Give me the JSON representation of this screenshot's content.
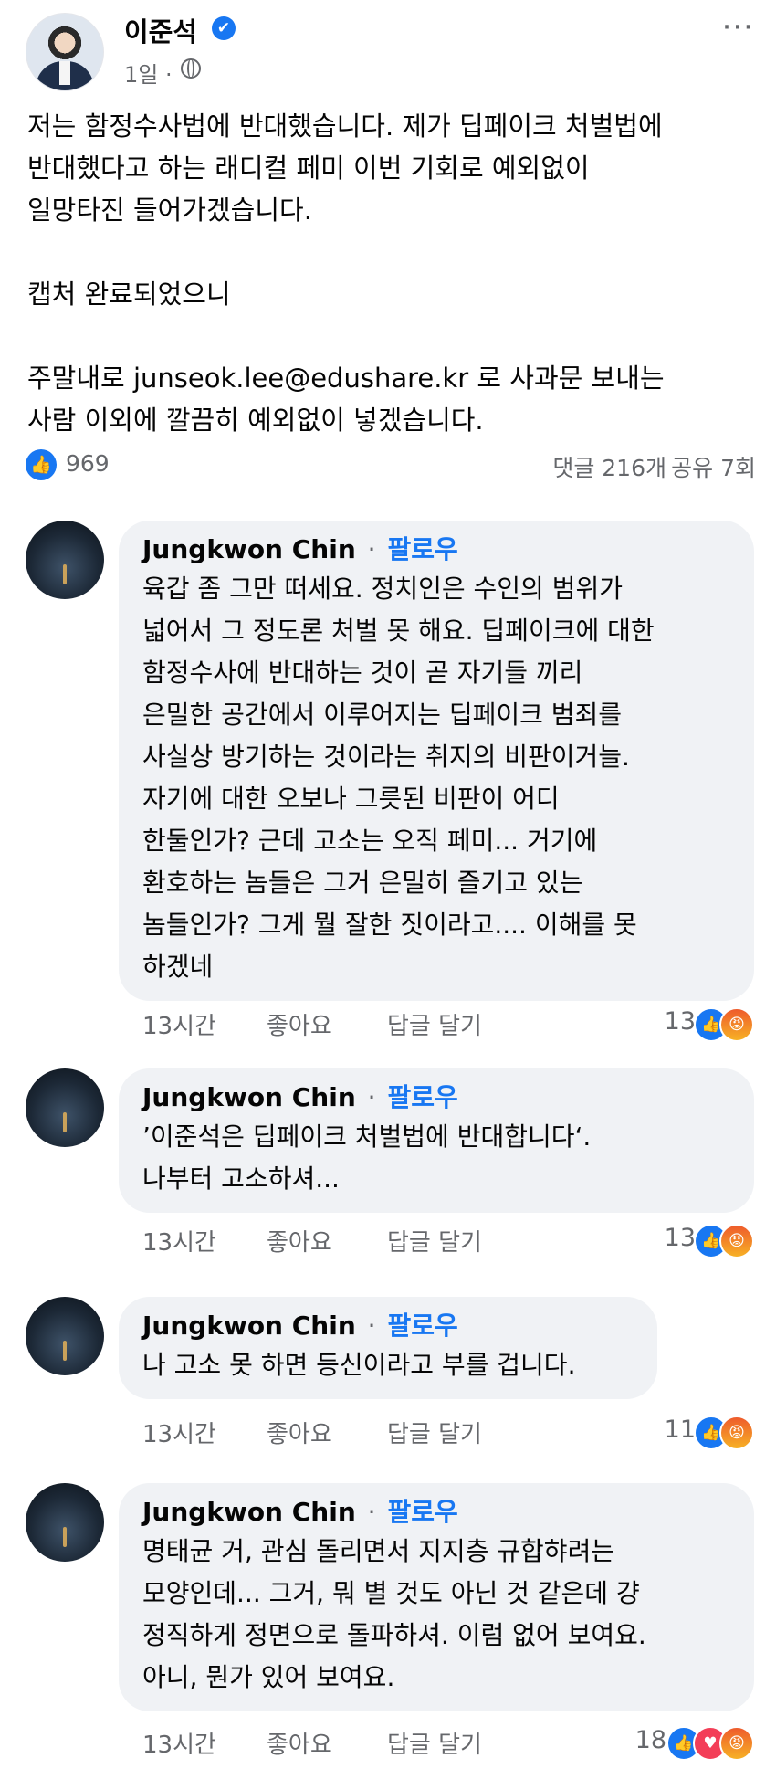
{
  "post": {
    "author": "이준석",
    "time": "1일 ·",
    "more": "⋮⋮⋮",
    "lines": [
      "저는 함정수사법에 반대했습니다. 제가 딥페이크 처벌법에",
      "반대했다고 하는 래디컬 페미 이번 기회로 예외없이",
      "일망타진 들어가겠습니다.",
      "",
      "캡처 완료되었으니",
      "",
      "주말내로 junseok.lee@edushare.kr 로 사과문 보내는",
      "사람 이외에 깔끔히 예외없이 넣겠습니다."
    ],
    "like_count": "969",
    "comments_count": "댓글 216개",
    "share_count": "공유 7회"
  },
  "icons": {
    "verified": "✔",
    "like": "👍",
    "love": "♥",
    "angry": "😡"
  },
  "comments": [
    {
      "name": "Jungkwon Chin",
      "dot": "·",
      "follow": "팔로우",
      "lines": [
        "육갑 좀 그만 떠세요. 정치인은 수인의 범위가",
        "넓어서 그 정도론 처벌 못 해요. 딥페이크에 대한",
        "함정수사에 반대하는 것이 곧 자기들 끼리",
        "은밀한 공간에서 이루어지는 딥페이크 범죄를",
        "사실상 방기하는 것이라는 취지의 비판이거늘.",
        "자기에 대한 오보나 그릇된 비판이 어디",
        "한둘인가? 근데 고소는 오직 페미... 거기에",
        "환호하는 놈들은 그거 은밀히 즐기고 있는",
        "놈들인가? 그게 뭘 잘한 짓이라고.... 이해를 못",
        "하겠네"
      ],
      "time": "13시간",
      "like_label": "좋아요",
      "reply_label": "답글 달기",
      "reactions": "13"
    },
    {
      "name": "Jungkwon Chin",
      "dot": "·",
      "follow": "팔로우",
      "lines": [
        "’이준석은 딥페이크 처벌법에 반대합니다‘.",
        "나부터 고소하셔..."
      ],
      "time": "13시간",
      "like_label": "좋아요",
      "reply_label": "답글 달기",
      "reactions": "13"
    },
    {
      "name": "Jungkwon Chin",
      "dot": "·",
      "follow": "팔로우",
      "lines": [
        "나 고소 못 하면 등신이라고 부를 겁니다."
      ],
      "time": "13시간",
      "like_label": "좋아요",
      "reply_label": "답글 달기",
      "reactions": "11"
    },
    {
      "name": "Jungkwon Chin",
      "dot": "·",
      "follow": "팔로우",
      "lines": [
        "명태균 거, 관심 돌리면서 지지층 규합햐려는",
        "모양인데... 그거, 뭐 별 것도 아닌 것 같은데 걍",
        "정직하게 정면으로 돌파하셔. 이럼 없어 보여요.",
        "아니, 뭔가 있어 보여요."
      ],
      "time": "13시간",
      "like_label": "좋아요",
      "reply_label": "답글 달기",
      "reactions": "18"
    }
  ]
}
